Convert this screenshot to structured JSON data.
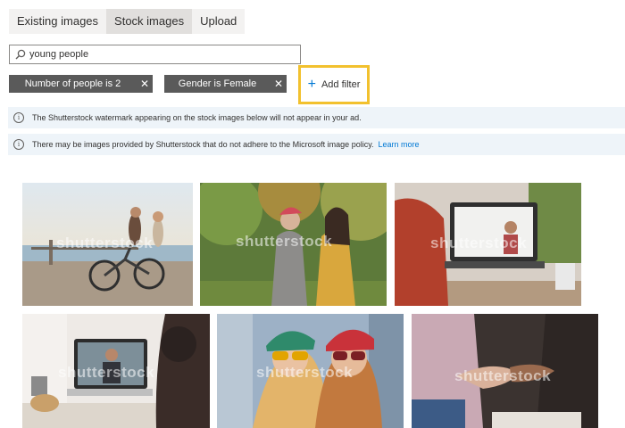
{
  "tabs": [
    {
      "label": "Existing images"
    },
    {
      "label": "Stock images"
    },
    {
      "label": "Upload"
    }
  ],
  "search": {
    "value": "young people"
  },
  "filters": [
    {
      "label": "Number of people is 2"
    },
    {
      "label": "Gender is Female"
    }
  ],
  "add_filter": {
    "label": "Add filter"
  },
  "banners": [
    {
      "text": "The Shutterstock watermark appearing on the stock images below will not appear in your ad."
    },
    {
      "text": "There may be images provided by Shutterstock that do not adhere to the Microsoft image policy.",
      "link": "Learn more"
    }
  ],
  "watermark": "shutterstock",
  "colors": {
    "accent": "#0078d4",
    "highlight": "#f2c12e",
    "chip": "#5a5a5a",
    "banner": "#eef4f9"
  }
}
